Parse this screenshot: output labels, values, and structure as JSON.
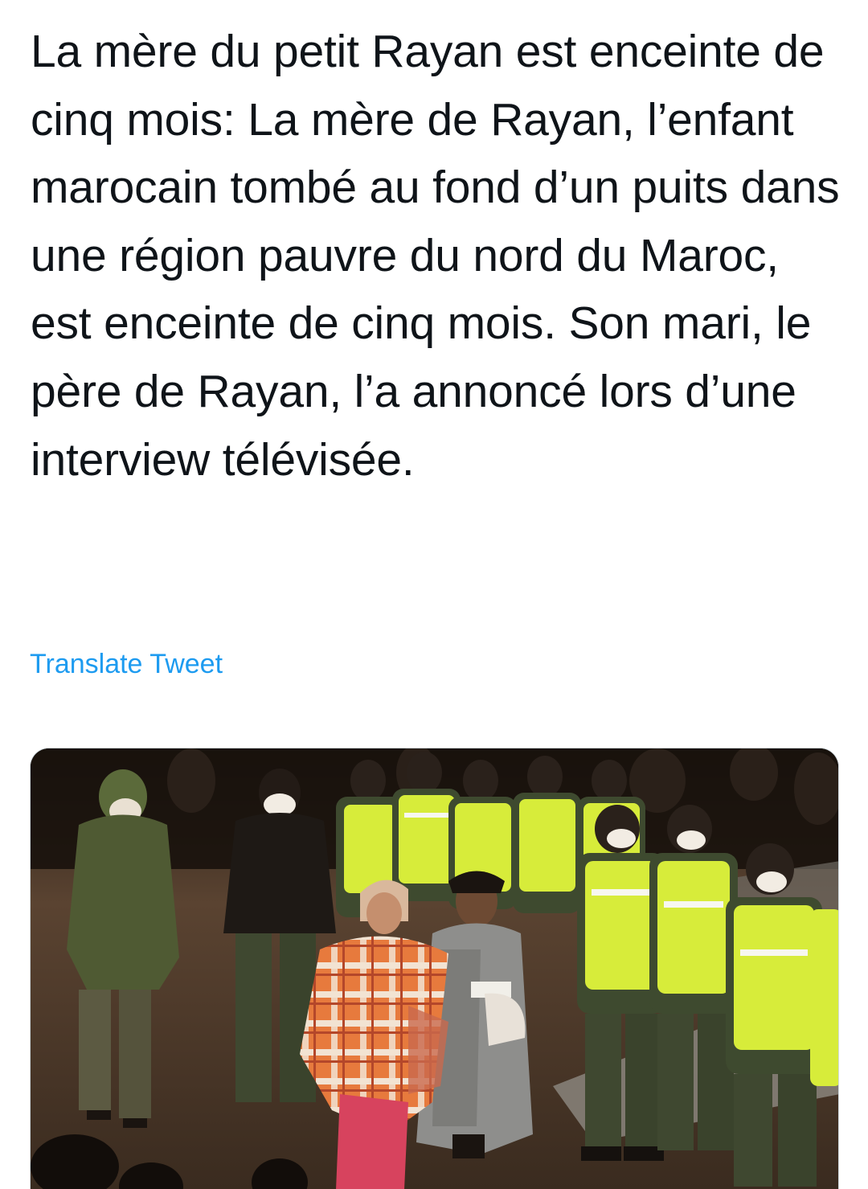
{
  "tweet": {
    "text": "La mère du petit Rayan est enceinte de cinq mois: La mère de Rayan, l’enfant marocain tombé au fond d’un puits dans une région pauvre du nord du Maroc, est enceinte de cinq mois. Son mari, le père de Rayan, l’a annoncé lors d’une interview télévisée.",
    "translate_label": "Translate Tweet"
  },
  "media": {
    "alt": "",
    "icon": "photo"
  },
  "colors": {
    "text": "#0f1419",
    "link": "#1d9bf0",
    "border": "#cfd9de",
    "vest": "#d7ec3a"
  }
}
